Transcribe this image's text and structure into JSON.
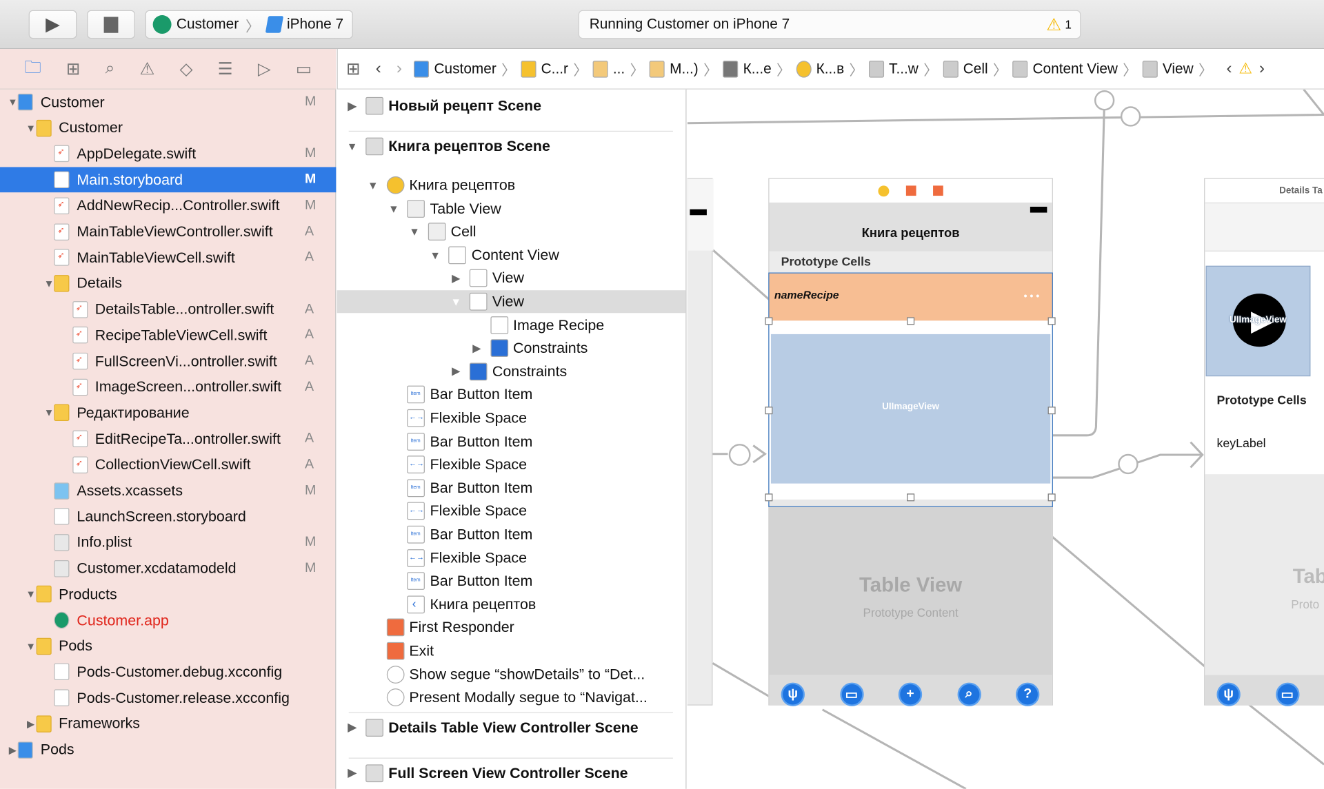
{
  "toolbar": {
    "run_icon": "play-icon",
    "stop_icon": "stop-icon",
    "scheme": "Customer",
    "device": "iPhone 7",
    "status": "Running Customer on iPhone 7",
    "warning_count": "1",
    "warning_color": "#f5b800"
  },
  "navigator_tabs": [
    "folder-icon",
    "hierarchy-icon",
    "search-icon",
    "warning-icon",
    "test-icon",
    "debug-icon",
    "breakpoint-icon",
    "report-icon"
  ],
  "jumpbar": {
    "items": [
      "Customer",
      "C...r",
      "...",
      "M...)",
      "К...е",
      "К...в",
      "T...w",
      "Cell",
      "Content View",
      "View"
    ]
  },
  "navigator": {
    "items": [
      {
        "label": "Customer",
        "level": 0,
        "disc": "open",
        "icon": "project",
        "badge": "M"
      },
      {
        "label": "Customer",
        "level": 1,
        "disc": "open",
        "icon": "folder",
        "badge": ""
      },
      {
        "label": "AppDelegate.swift",
        "level": 2,
        "icon": "swift",
        "badge": "M"
      },
      {
        "label": "Main.storyboard",
        "level": 2,
        "icon": "storyboard",
        "badge": "M",
        "selected": true
      },
      {
        "label": "AddNewRecip...Controller.swift",
        "level": 2,
        "icon": "swift",
        "badge": "M"
      },
      {
        "label": "MainTableViewController.swift",
        "level": 2,
        "icon": "swift",
        "badge": "A"
      },
      {
        "label": "MainTableViewCell.swift",
        "level": 2,
        "icon": "swift",
        "badge": "A"
      },
      {
        "label": "Details",
        "level": 2,
        "disc": "open",
        "icon": "folder",
        "badge": ""
      },
      {
        "label": "DetailsTable...ontroller.swift",
        "level": 3,
        "icon": "swift",
        "badge": "A"
      },
      {
        "label": "RecipeTableViewCell.swift",
        "level": 3,
        "icon": "swift",
        "badge": "A"
      },
      {
        "label": "FullScreenVi...ontroller.swift",
        "level": 3,
        "icon": "swift",
        "badge": "A"
      },
      {
        "label": "ImageScreen...ontroller.swift",
        "level": 3,
        "icon": "swift",
        "badge": "A"
      },
      {
        "label": "Редактирование",
        "level": 2,
        "disc": "open",
        "icon": "folder",
        "badge": ""
      },
      {
        "label": "EditRecipeTa...ontroller.swift",
        "level": 3,
        "icon": "swift",
        "badge": "A"
      },
      {
        "label": "CollectionViewCell.swift",
        "level": 3,
        "icon": "swift",
        "badge": "A"
      },
      {
        "label": "Assets.xcassets",
        "level": 2,
        "icon": "assets",
        "badge": "M"
      },
      {
        "label": "LaunchScreen.storyboard",
        "level": 2,
        "icon": "storyboard",
        "badge": ""
      },
      {
        "label": "Info.plist",
        "level": 2,
        "icon": "plist",
        "badge": "M"
      },
      {
        "label": "Customer.xcdatamodeld",
        "level": 2,
        "icon": "datamodel",
        "badge": "M"
      },
      {
        "label": "Products",
        "level": 1,
        "disc": "open",
        "icon": "folder",
        "badge": ""
      },
      {
        "label": "Customer.app",
        "level": 2,
        "icon": "app",
        "badge": "",
        "red": true
      },
      {
        "label": "Pods",
        "level": 1,
        "disc": "open",
        "icon": "folder",
        "badge": ""
      },
      {
        "label": "Pods-Customer.debug.xcconfig",
        "level": 2,
        "icon": "config",
        "badge": ""
      },
      {
        "label": "Pods-Customer.release.xcconfig",
        "level": 2,
        "icon": "config",
        "badge": ""
      },
      {
        "label": "Frameworks",
        "level": 1,
        "disc": "closed",
        "icon": "folder",
        "badge": ""
      },
      {
        "label": "Pods",
        "level": 0,
        "disc": "closed",
        "icon": "project",
        "badge": ""
      }
    ]
  },
  "outline": {
    "items": [
      {
        "label": "Новый рецепт Scene",
        "level": 0,
        "disc": "closed",
        "icon": "scene",
        "bold": true
      },
      {
        "sep": true
      },
      {
        "label": "Книга рецептов Scene",
        "level": 0,
        "disc": "open",
        "icon": "scene",
        "bold": true
      },
      {
        "label": "Книга рецептов",
        "level": 1,
        "disc": "open",
        "icon": "controller"
      },
      {
        "label": "Table View",
        "level": 2,
        "disc": "open",
        "icon": "table"
      },
      {
        "label": "Cell",
        "level": 3,
        "disc": "open",
        "icon": "cell"
      },
      {
        "label": "Content View",
        "level": 4,
        "disc": "open",
        "icon": "view"
      },
      {
        "label": "View",
        "level": 5,
        "disc": "closed",
        "icon": "view"
      },
      {
        "label": "View",
        "level": 5,
        "disc": "open",
        "icon": "view",
        "selected": true
      },
      {
        "label": "Image Recipe",
        "level": 6,
        "icon": "image"
      },
      {
        "label": "Constraints",
        "level": 6,
        "disc": "closed",
        "icon": "constraints"
      },
      {
        "label": "Constraints",
        "level": 5,
        "disc": "closed",
        "icon": "constraints"
      },
      {
        "label": "Bar Button Item",
        "level": 2,
        "icon": "item"
      },
      {
        "label": "Flexible Space",
        "level": 2,
        "icon": "space"
      },
      {
        "label": "Bar Button Item",
        "level": 2,
        "icon": "item"
      },
      {
        "label": "Flexible Space",
        "level": 2,
        "icon": "space"
      },
      {
        "label": "Bar Button Item",
        "level": 2,
        "icon": "item"
      },
      {
        "label": "Flexible Space",
        "level": 2,
        "icon": "space"
      },
      {
        "label": "Bar Button Item",
        "level": 2,
        "icon": "item"
      },
      {
        "label": "Flexible Space",
        "level": 2,
        "icon": "space"
      },
      {
        "label": "Bar Button Item",
        "level": 2,
        "icon": "item"
      },
      {
        "label": "Книга рецептов",
        "level": 2,
        "icon": "back"
      },
      {
        "label": "First Responder",
        "level": 1,
        "icon": "responder"
      },
      {
        "label": "Exit",
        "level": 1,
        "icon": "exit"
      },
      {
        "label": "Show segue “showDetails” to “Det...",
        "level": 1,
        "icon": "segue"
      },
      {
        "label": "Present Modally segue to “Navigat...",
        "level": 1,
        "icon": "segue"
      },
      {
        "sep": true
      },
      {
        "label": "Details Table View Controller Scene",
        "level": 0,
        "disc": "closed",
        "icon": "scene",
        "bold": true
      },
      {
        "sep": true
      },
      {
        "label": "Full Screen View Controller Scene",
        "level": 0,
        "disc": "closed",
        "icon": "scene",
        "bold": true
      }
    ]
  },
  "canvas": {
    "main_scene": {
      "nav_title": "Книга рецептов",
      "prototype_cells": "Prototype Cells",
      "cell_label": "nameRecipe",
      "image_view": "UIImageView",
      "table_title": "Table View",
      "table_subtitle": "Prototype Content",
      "cell_color": "#f7be93",
      "image_color": "#b8cce4",
      "tab_icons": [
        "restaurant-icon",
        "folder-icon",
        "plus-icon",
        "zoom-icon",
        "help-icon"
      ]
    },
    "details_scene": {
      "title": "Details Ta",
      "image_view": "UIImageView",
      "prototype_cells": "Prototype Cells",
      "key_label": "keyLabel",
      "table_title": "Tab",
      "table_subtitle": "Proto",
      "tab_icons": [
        "restaurant-icon",
        "folder-icon"
      ]
    }
  }
}
